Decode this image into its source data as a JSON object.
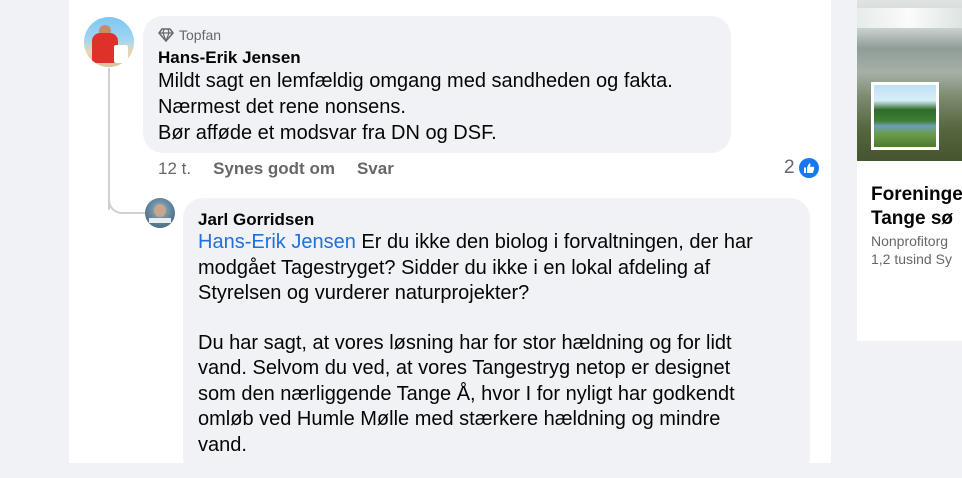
{
  "comment": {
    "badge": "Topfan",
    "author": "Hans-Erik Jensen",
    "lines": [
      "Mildt sagt en lemfældig omgang med sandheden og fakta.",
      "Nærmest det rene nonsens.",
      "Bør afføde et modsvar fra DN og DSF."
    ],
    "time": "12 t.",
    "like_label": "Synes godt om",
    "reply_label": "Svar",
    "reaction_count": "2"
  },
  "reply": {
    "author": "Jarl Gorridsen",
    "mention": "Hans-Erik Jensen",
    "first_line_rest": " Er du ikke den biolog i forvaltningen, der har",
    "lines_p1": [
      "modgået Tagestryget? Sidder du ikke i en lokal afdeling af",
      "Styrelsen og vurderer naturprojekter?"
    ],
    "lines_p2": [
      "Du har sagt, at vores løsning har for stor hældning og for lidt",
      "vand. Selvom du ved, at vores Tangestryg netop er designet",
      "som den nærliggende Tange Å, hvor I for nyligt har godkendt",
      "omløb ved Humle Mølle med stærkere hældning og mindre",
      "vand."
    ]
  },
  "sidebar": {
    "title_lines": [
      "Foreninge",
      "Tange sø"
    ],
    "category": "Nonprofitorg",
    "followers": "1,2 tusind Sy"
  },
  "colors": {
    "bubble": "#f0f2f5",
    "mention": "#216fdb",
    "like_blue": "#1877f2",
    "meta": "#65676b"
  },
  "icons": [
    "diamond-icon",
    "like-reaction-icon"
  ]
}
